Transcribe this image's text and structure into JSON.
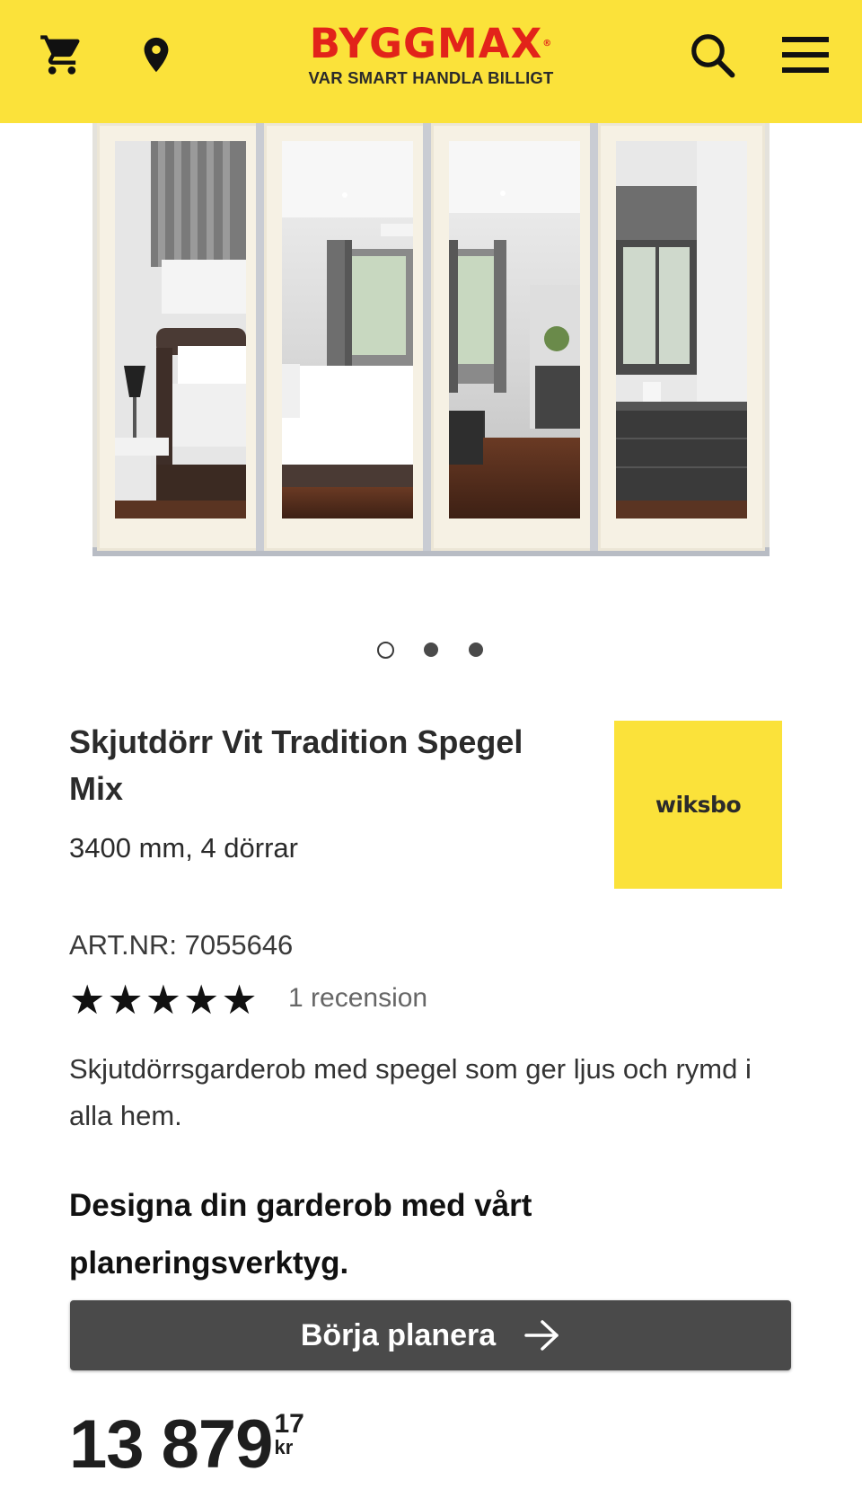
{
  "header": {
    "logo_word": "BYGGMAX",
    "logo_reg": "®",
    "tagline": "VAR SMART HANDLA BILLIGT",
    "icons": [
      "cart-icon",
      "location-pin-icon",
      "search-icon",
      "menu-icon"
    ]
  },
  "gallery": {
    "slide_count": 3,
    "active_slide": 1
  },
  "product": {
    "title": "Skjutdörr Vit Tradition Spegel Mix",
    "subtitle": "3400 mm, 4 dörrar",
    "brand": "wiksbo",
    "art_nr": "ART.NR: 7055646",
    "rating": 5,
    "rating_max": 5,
    "reviews": "1 recension",
    "description": "Skjutdörrsgarderob med spegel som ger ljus och rymd i alla hem.",
    "design_heading": "Designa din garderob med vårt planeringsverktyg.",
    "cta_label": "Börja planera",
    "price_main": "13 879",
    "price_cents": "17",
    "price_currency": "kr"
  },
  "colors": {
    "brand_yellow": "#fbe23a",
    "brand_red": "#e2231a",
    "button_gray": "#4a4a4a",
    "text_dark": "#2b2b2b"
  }
}
